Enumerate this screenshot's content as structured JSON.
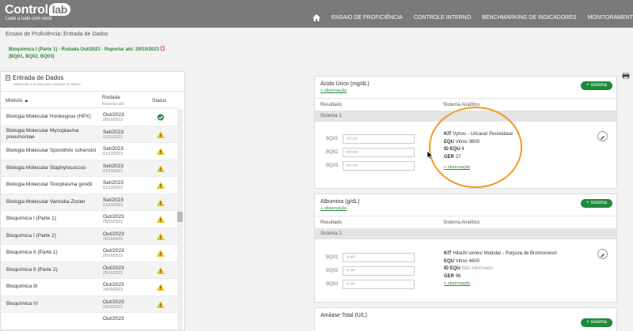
{
  "header": {
    "logo_main": "Control",
    "logo_badge": "lab",
    "logo_tagline": "Lado a lado com você",
    "nav": [
      "ENSAIO DE PROFICIÊNCIA",
      "CONTROLE INTERNO",
      "BENCHMARKING DE INDICADORES",
      "MONITORAMENT"
    ]
  },
  "breadcrumb": "Ensaio de Proficiência: Entrada de Dados",
  "title_line1": "Bioquímica I (Parte 1) - Rodada Out/2023 - Reportar até: 29/10/2023",
  "title_line2": "(BQ01, BQ02, BQ03)",
  "left_panel": {
    "title": "Entrada de Dados",
    "subtitle": "Selecione o ensaio para reportar os dados",
    "col_modulo": "Módulo",
    "col_rodada": "Rodada",
    "col_rodada_sub": "Reportar até",
    "col_status": "Status",
    "rows": [
      {
        "modulo": "Biologia Molecular Honkeypox (HPX)",
        "rodada": "Out/2023",
        "data": "29/10/2023",
        "status": "ok"
      },
      {
        "modulo": "Biologia Molecular Mycoplasma pneumoniae",
        "rodada": "Set/2023",
        "data": "01/10/2023",
        "status": "warn"
      },
      {
        "modulo": "Biologia Molecular Sporothrix schenckii",
        "rodada": "Set/2023",
        "data": "01/10/2023",
        "status": "warn"
      },
      {
        "modulo": "Biologia Molecular Staphylococcus",
        "rodada": "Set/2023",
        "data": "01/10/2023",
        "status": "warn"
      },
      {
        "modulo": "Biologia Molecular Toxoplasma gondii",
        "rodada": "Set/2023",
        "data": "01/10/2023",
        "status": "warn"
      },
      {
        "modulo": "Biologia Molecular Varicella-Zoster",
        "rodada": "Set/2023",
        "data": "01/10/2023",
        "status": "warn"
      },
      {
        "modulo": "Bioquímica I (Parte 1)",
        "rodada": "Out/2023",
        "data": "29/10/2023",
        "status": "warn"
      },
      {
        "modulo": "Bioquímica I (Parte 2)",
        "rodada": "Out/2023",
        "data": "29/10/2023",
        "status": "warn"
      },
      {
        "modulo": "Bioquímica II (Parte 1)",
        "rodada": "Out/2023",
        "data": "29/10/2023",
        "status": "warn"
      },
      {
        "modulo": "Bioquímica II (Parte 2)",
        "rodada": "Out/2023",
        "data": "29/10/2023",
        "status": "warn"
      },
      {
        "modulo": "Bioquímica III",
        "rodada": "Out/2023",
        "data": "29/10/2023",
        "status": "warn"
      },
      {
        "modulo": "Bioquímica IV",
        "rodada": "Out/2023",
        "data": "29/10/2023",
        "status": "warn"
      },
      {
        "modulo": "",
        "rodada": "Out/2023",
        "data": "",
        "status": ""
      }
    ]
  },
  "cards": [
    {
      "title": "Ácido Úrico (mg/dL)",
      "obs": "+ observação",
      "btn": "+ sistema",
      "col_resultado": "Resultado",
      "col_sistema": "Sistema Analítico",
      "sistema": "Sistema 1",
      "fields": [
        "BQ01",
        "BQ02",
        "BQ03"
      ],
      "placeholder": "##.##",
      "kit_label": "KIT",
      "kit": "Vytros - Uricase/ Peroxidase",
      "equ_label": "EQU",
      "equ": "Vitros 3600",
      "idequ_label": "ID EQU",
      "idequ": "4",
      "ger_label": "GER",
      "ger": "27",
      "sys_obs": "+ observação"
    },
    {
      "title": "Albumina (g/dL)",
      "obs": "+ observação",
      "btn": "+ sistema",
      "col_resultado": "Resultado",
      "col_sistema": "Sistema Analítico",
      "sistema": "Sistema 1",
      "fields": [
        "BQ01",
        "BQ02",
        "BQ03"
      ],
      "placeholder": "#.##",
      "kit_label": "KIT",
      "kit": "Hitachi séries/ Modular - Púrpura de Bromocresol",
      "equ_label": "EQU",
      "equ": "Vitros 4600",
      "idequ_label": "ID EQU",
      "idequ": "Não informado",
      "ger_label": "GER",
      "ger": "96",
      "sys_obs": "+ observação"
    },
    {
      "title": "Amilase Total (U/L)",
      "obs": "",
      "btn": "+ sistema"
    }
  ]
}
